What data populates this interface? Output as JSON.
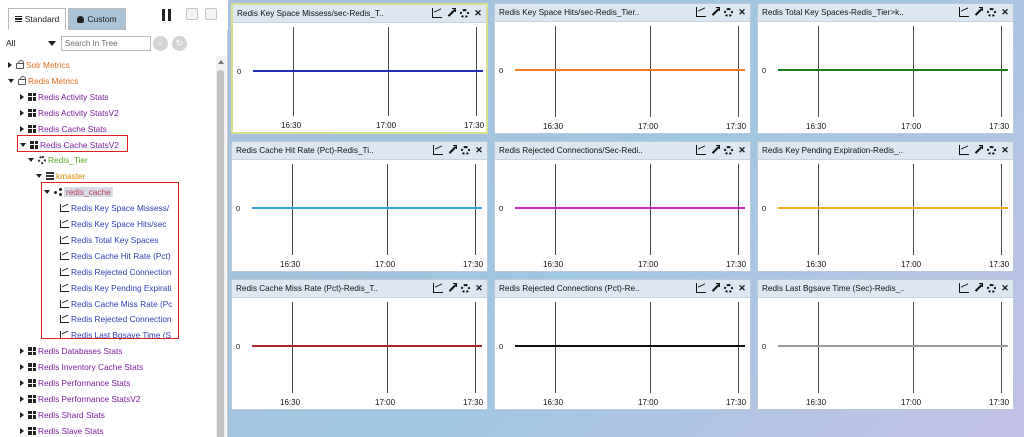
{
  "tabs": {
    "standard": "Standard",
    "custom": "Custom"
  },
  "filter": {
    "selected": "All",
    "search_placeholder": "Search In Tree"
  },
  "tree": [
    {
      "label": "Solr Metrics",
      "level": 0,
      "expand": "right",
      "icon": "lock",
      "color": "c-orange"
    },
    {
      "label": "Redis Metrics",
      "level": 0,
      "expand": "down",
      "icon": "lock",
      "color": "c-orange"
    },
    {
      "label": "Redis Activity Stats",
      "level": 1,
      "expand": "right",
      "icon": "grid",
      "color": "c-purple"
    },
    {
      "label": "Redis Activity StatsV2",
      "level": 1,
      "expand": "right",
      "icon": "grid",
      "color": "c-purple"
    },
    {
      "label": "Redis Cache Stats",
      "level": 1,
      "expand": "right",
      "icon": "grid",
      "color": "c-purple"
    },
    {
      "label": "Redis Cache StatsV2",
      "level": 1,
      "expand": "down",
      "icon": "grid",
      "color": "c-purple"
    },
    {
      "label": "Redis_Tier",
      "level": 2,
      "expand": "down",
      "icon": "gear",
      "color": "c-green"
    },
    {
      "label": "kmaster",
      "level": 3,
      "expand": "down",
      "icon": "server",
      "color": "c-amber"
    },
    {
      "label": "redis_cache",
      "level": 4,
      "expand": "down",
      "icon": "share",
      "color": "c-pink"
    },
    {
      "label": "Redis Key Space Missess/",
      "level": 5,
      "expand": "none",
      "icon": "chart",
      "color": "c-blue"
    },
    {
      "label": "Redis Key Space Hits/sec",
      "level": 5,
      "expand": "none",
      "icon": "chart",
      "color": "c-blue"
    },
    {
      "label": "Redis Total Key Spaces",
      "level": 5,
      "expand": "none",
      "icon": "chart",
      "color": "c-blue"
    },
    {
      "label": "Redis Cache Hit Rate (Pct)",
      "level": 5,
      "expand": "none",
      "icon": "chart",
      "color": "c-blue"
    },
    {
      "label": "Redis Rejected Connection",
      "level": 5,
      "expand": "none",
      "icon": "chart",
      "color": "c-blue"
    },
    {
      "label": "Redis Key Pending Expirati",
      "level": 5,
      "expand": "none",
      "icon": "chart",
      "color": "c-blue"
    },
    {
      "label": "Redis Cache Miss Rate (Pc",
      "level": 5,
      "expand": "none",
      "icon": "chart",
      "color": "c-blue"
    },
    {
      "label": "Redis Rejected Connection",
      "level": 5,
      "expand": "none",
      "icon": "chart",
      "color": "c-blue"
    },
    {
      "label": "Redis Last Bgsave Time (S",
      "level": 5,
      "expand": "none",
      "icon": "chart",
      "color": "c-blue"
    },
    {
      "label": "Redis Databases Stats",
      "level": 1,
      "expand": "right",
      "icon": "grid",
      "color": "c-purple"
    },
    {
      "label": "Redis Inventory Cache Stats",
      "level": 1,
      "expand": "right",
      "icon": "grid",
      "color": "c-purple"
    },
    {
      "label": "Redis Performance Stats",
      "level": 1,
      "expand": "right",
      "icon": "grid",
      "color": "c-purple"
    },
    {
      "label": "Redis Performance StatsV2",
      "level": 1,
      "expand": "right",
      "icon": "grid",
      "color": "c-purple"
    },
    {
      "label": "Redis Shard Stats",
      "level": 1,
      "expand": "right",
      "icon": "grid",
      "color": "c-purple"
    },
    {
      "label": "Redis Slave Stats",
      "level": 1,
      "expand": "right",
      "icon": "grid",
      "color": "c-purple"
    }
  ],
  "panels": [
    {
      "title": "Redis Key Space Missess/sec-Redis_T..",
      "color": "#1f2fb5",
      "zero": "0",
      "ticks": [
        "16:30",
        "17:00",
        "17:30"
      ]
    },
    {
      "title": "Redis Key Space Hits/sec-Redis_Tier..",
      "color": "#f07a2a",
      "zero": "0",
      "ticks": [
        "16:30",
        "17:00",
        "17:30"
      ]
    },
    {
      "title": "Redis Total Key Spaces-Redis_Tier>k..",
      "color": "#1e7a1e",
      "zero": "0",
      "ticks": [
        "16:30",
        "17:00",
        "17:30"
      ]
    },
    {
      "title": "Redis Cache Hit Rate (Pct)-Redis_Ti..",
      "color": "#3aa3e0",
      "zero": "0",
      "ticks": [
        "16:30",
        "17:00",
        "17:30"
      ]
    },
    {
      "title": "Redis Rejected Connections/Sec-Redi..",
      "color": "#c12bc4",
      "zero": "0",
      "ticks": [
        "16:30",
        "17:00",
        "17:30"
      ]
    },
    {
      "title": "Redis Key Pending Expiration-Redis_..",
      "color": "#f0b020",
      "zero": "0",
      "ticks": [
        "16:30",
        "17:00",
        "17:30"
      ]
    },
    {
      "title": "Redis Cache Miss Rate (Pct)-Redis_T..",
      "color": "#a52a2a",
      "zero": "0",
      "ticks": [
        "16:30",
        "17:00",
        "17:30"
      ]
    },
    {
      "title": "Redis Rejected Connections (Pct)-Re..",
      "color": "#111111",
      "zero": "0",
      "ticks": [
        "16:30",
        "17:00",
        "17:30"
      ]
    },
    {
      "title": "Redis Last Bgsave Time (Sec)-Redis_..",
      "color": "#9a9a9a",
      "zero": "0",
      "ticks": [
        "16:30",
        "17:00",
        "17:30"
      ]
    }
  ]
}
